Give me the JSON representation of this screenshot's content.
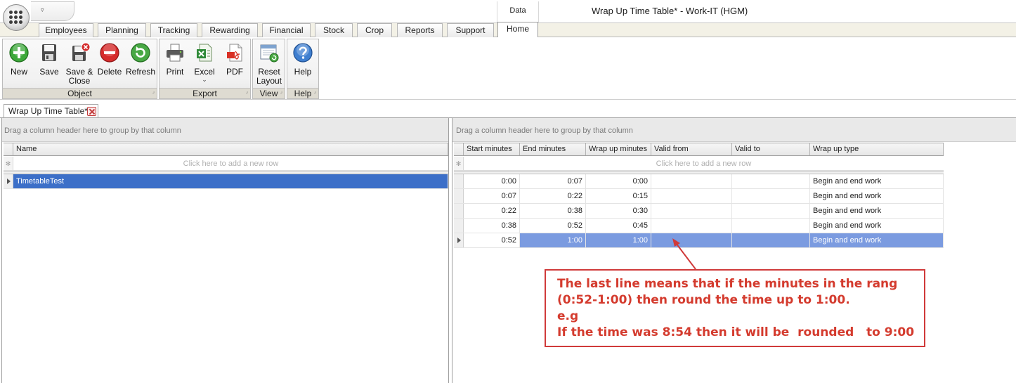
{
  "window": {
    "title": "Wrap Up Time Table* - Work-IT (HGM)",
    "context_tab_group": "Data"
  },
  "ribbon_tabs": [
    {
      "label": "Employees",
      "active": false
    },
    {
      "label": "Planning",
      "active": false
    },
    {
      "label": "Tracking",
      "active": false
    },
    {
      "label": "Rewarding",
      "active": false
    },
    {
      "label": "Financial",
      "active": false
    },
    {
      "label": "Stock",
      "active": false
    },
    {
      "label": "Crop",
      "active": false
    },
    {
      "label": "Reports",
      "active": false
    },
    {
      "label": "Support",
      "active": false
    },
    {
      "label": "Home",
      "active": true
    }
  ],
  "ribbon_groups": {
    "object": {
      "label": "Object",
      "buttons": [
        {
          "label": "New",
          "icon": "add-icon"
        },
        {
          "label": "Save",
          "icon": "floppy-disk-icon"
        },
        {
          "label": "Save & Close",
          "icon": "floppy-disk-close-icon"
        },
        {
          "label": "Delete",
          "icon": "delete-icon"
        },
        {
          "label": "Refresh",
          "icon": "refresh-icon"
        }
      ]
    },
    "export": {
      "label": "Export",
      "buttons": [
        {
          "label": "Print",
          "icon": "printer-icon"
        },
        {
          "label": "Excel",
          "icon": "excel-icon",
          "dropdown_glyph": "⌄"
        },
        {
          "label": "PDF",
          "icon": "pdf-icon"
        }
      ]
    },
    "view": {
      "label": "View",
      "buttons": [
        {
          "label": "Reset Layout",
          "icon": "reset-layout-icon"
        }
      ]
    },
    "help": {
      "label": "Help",
      "buttons": [
        {
          "label": "Help",
          "icon": "help-icon"
        }
      ]
    }
  },
  "document_tab": {
    "label": "Wrap Up Time Table*"
  },
  "left_grid": {
    "group_panel_text": "Drag a column header here to group by that column",
    "columns": [
      "Name"
    ],
    "new_row_text": "Click here to add a new row",
    "rows": [
      {
        "name": "TimetableTest",
        "selected": true
      }
    ]
  },
  "right_grid": {
    "group_panel_text": "Drag a column header here to group by that column",
    "columns": [
      "Start minutes",
      "End minutes",
      "Wrap up minutes",
      "Valid from",
      "Valid to",
      "Wrap up type"
    ],
    "new_row_text": "Click here to add a new row",
    "rows": [
      {
        "start": "0:00",
        "end": "0:07",
        "wrap": "0:00",
        "valid_from": "",
        "valid_to": "",
        "type": "Begin and end work",
        "selected": false
      },
      {
        "start": "0:07",
        "end": "0:22",
        "wrap": "0:15",
        "valid_from": "",
        "valid_to": "",
        "type": "Begin and end work",
        "selected": false
      },
      {
        "start": "0:22",
        "end": "0:38",
        "wrap": "0:30",
        "valid_from": "",
        "valid_to": "",
        "type": "Begin and end work",
        "selected": false
      },
      {
        "start": "0:38",
        "end": "0:52",
        "wrap": "0:45",
        "valid_from": "",
        "valid_to": "",
        "type": "Begin and end work",
        "selected": false
      },
      {
        "start": "0:52",
        "end": "1:00",
        "wrap": "1:00",
        "valid_from": "",
        "valid_to": "",
        "type": "Begin and end work",
        "selected": true
      }
    ]
  },
  "annotation": {
    "lines": [
      "The last line means that if the minutes in the rang",
      "(0:52-1:00) then round the time up to 1:00.",
      "e.g",
      "If the time was 8:54 then it will be  rounded   to 9:00"
    ],
    "color": "#d43b2e"
  },
  "colors": {
    "selection_dark": "#3c6fc8",
    "selection_light": "#7b9be0",
    "callout_border": "#d03a3a"
  }
}
